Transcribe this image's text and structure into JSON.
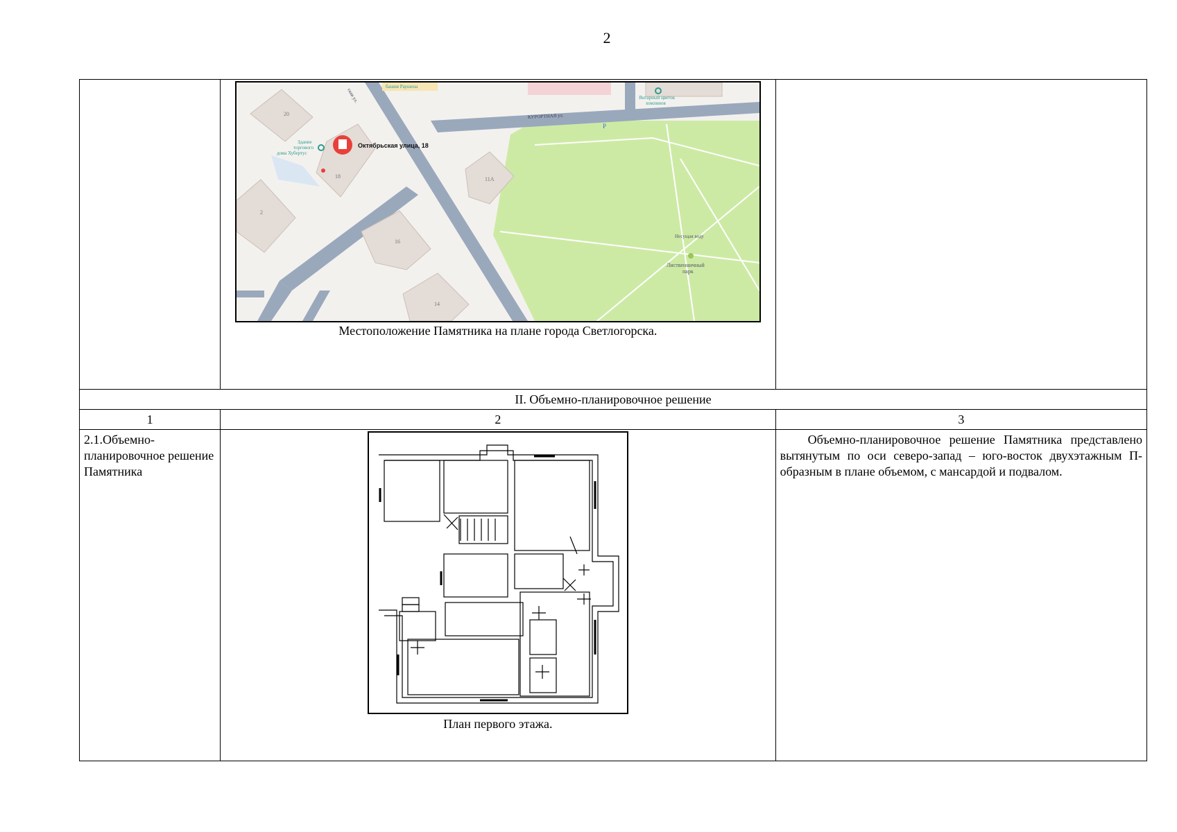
{
  "page": {
    "number": "2"
  },
  "map": {
    "caption": "Местоположение Памятника на плане города Светлогорска.",
    "labels": {
      "pin": "Октябрьская улица, 18",
      "poi_house_1": "Здание",
      "poi_house_2": "торгового",
      "poi_house_3": "дома Хубертус",
      "poi_amber_1": "Янтарный цветок",
      "poi_amber_2": "хомлинов",
      "street": "КУРОРТНАЯ ул.",
      "street_side": "ская ул.",
      "tower": "башня Раушена",
      "park_1": "Лиственничный",
      "park_2": "парк",
      "statue": "Несущая воду",
      "parking": "P",
      "b20": "20",
      "b18": "18",
      "b11a": "11А",
      "b2": "2",
      "b16": "16",
      "b14": "14"
    },
    "colors": {
      "park": "#cdeaa5",
      "road": "#9aa8bc",
      "building": "#e4dcd6",
      "ground": "#f3f1ee",
      "pin": "#e8403a",
      "poi": "#2a9d8f"
    }
  },
  "section": {
    "title": "II. Объемно-планировочное решение",
    "col1": "1",
    "col2": "2",
    "col3": "3",
    "row_label": "2.1.Объемно-планировочное решение Памятника",
    "plan_caption": "План первого этажа.",
    "description": "Объемно-планировочное решение Памятника представлено вытянутым по оси северо-запад – юго-восток двухэтажным П-образным в плане объемом, с мансардой и подвалом."
  }
}
